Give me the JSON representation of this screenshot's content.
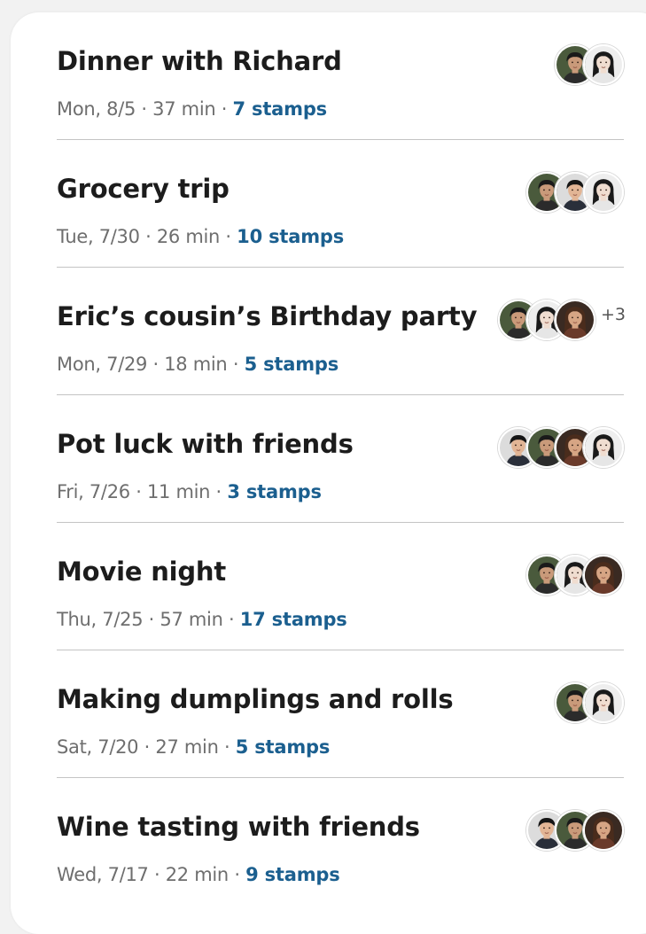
{
  "events": [
    {
      "title": "Dinner with Richard",
      "date": "Mon, 8/5",
      "duration": "37 min",
      "stamps": "7 stamps",
      "avatars": [
        "person-a-icon",
        "person-b-icon"
      ],
      "more": ""
    },
    {
      "title": "Grocery trip",
      "date": "Tue, 7/30",
      "duration": "26 min",
      "stamps": "10 stamps",
      "avatars": [
        "person-a-icon",
        "person-c-icon",
        "person-b-icon"
      ],
      "more": ""
    },
    {
      "title": "Eric’s cousin’s Birthday party",
      "date": "Mon, 7/29",
      "duration": "18 min",
      "stamps": "5 stamps",
      "avatars": [
        "person-a-icon",
        "person-b-icon",
        "person-d-icon"
      ],
      "more": "+3"
    },
    {
      "title": "Pot luck with friends",
      "date": "Fri, 7/26",
      "duration": "11 min",
      "stamps": "3 stamps",
      "avatars": [
        "person-c-icon",
        "person-a-icon",
        "person-d-icon",
        "person-b-icon"
      ],
      "more": ""
    },
    {
      "title": "Movie night",
      "date": "Thu, 7/25",
      "duration": "57 min",
      "stamps": "17 stamps",
      "avatars": [
        "person-a-icon",
        "person-b-icon",
        "person-d-icon"
      ],
      "more": ""
    },
    {
      "title": "Making dumplings and rolls",
      "date": "Sat, 7/20",
      "duration": "27 min",
      "stamps": "5 stamps",
      "avatars": [
        "person-a-icon",
        "person-b-icon"
      ],
      "more": ""
    },
    {
      "title": "Wine tasting with friends",
      "date": "Wed, 7/17",
      "duration": "22 min",
      "stamps": "9 stamps",
      "avatars": [
        "person-c-icon",
        "person-a-icon",
        "person-d-icon"
      ],
      "more": ""
    }
  ],
  "separator": " · ",
  "colors": {
    "title": "#1c1c1c",
    "meta": "#6e6e6e",
    "stamps_accent": "#1b5f8f",
    "divider": "#c4c4c4",
    "background": "#f2f2f2",
    "card": "#ffffff"
  }
}
